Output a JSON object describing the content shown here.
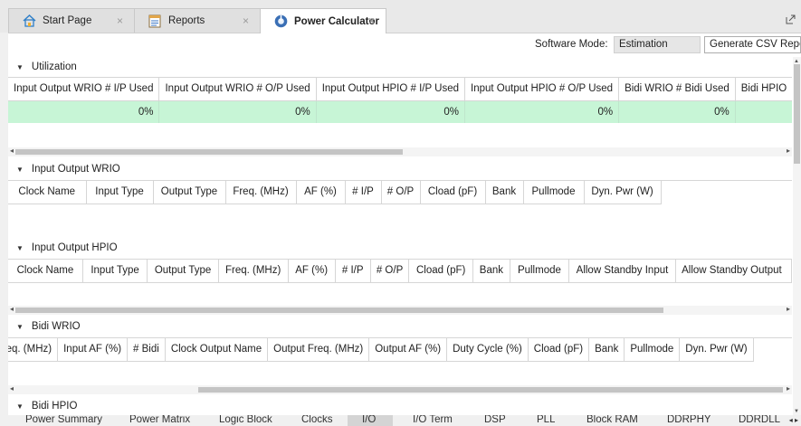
{
  "tabs": [
    {
      "label": "Start Page",
      "icon": "home-icon"
    },
    {
      "label": "Reports",
      "icon": "report-icon"
    },
    {
      "label": "Power Calculator",
      "icon": "power-calculator-icon"
    }
  ],
  "close_glyph": "×",
  "software_mode": {
    "label": "Software Mode:",
    "value": "Estimation",
    "generate_button": "Generate CSV Report"
  },
  "utilization": {
    "title": "Utilization",
    "headers": [
      "Input Output WRIO # I/P Used",
      "Input Output WRIO # O/P Used",
      "Input Output HPIO # I/P Used",
      "Input Output HPIO # O/P Used",
      "Bidi WRIO # Bidi Used",
      "Bidi HPIO"
    ],
    "values": [
      "0%",
      "0%",
      "0%",
      "0%",
      "0%",
      ""
    ]
  },
  "io_wrio": {
    "title": "Input Output WRIO",
    "headers": [
      "Clock Name",
      "Input Type",
      "Output Type",
      "Freq. (MHz)",
      "AF (%)",
      "# I/P",
      "# O/P",
      "Cload (pF)",
      "Bank",
      "Pullmode",
      "Dyn. Pwr (W)"
    ]
  },
  "io_hpio": {
    "title": "Input Output HPIO",
    "headers": [
      "Clock Name",
      "Input Type",
      "Output Type",
      "Freq. (MHz)",
      "AF (%)",
      "# I/P",
      "# O/P",
      "Cload (pF)",
      "Bank",
      "Pullmode",
      "Allow Standby Input",
      "Allow Standby Output"
    ]
  },
  "bidi_wrio": {
    "title": "Bidi WRIO",
    "headers": [
      "Input Freq. (MHz)",
      "Input AF (%)",
      "# Bidi",
      "Clock Output Name",
      "Output Freq. (MHz)",
      "Output AF (%)",
      "Duty Cycle (%)",
      "Cload (pF)",
      "Bank",
      "Pullmode",
      "Dyn. Pwr (W)"
    ]
  },
  "bidi_hpio": {
    "title": "Bidi HPIO"
  },
  "bottom_tabs": [
    "Power Summary",
    "Power Matrix",
    "Logic Block",
    "Clocks",
    "I/O",
    "I/O Term",
    "DSP",
    "PLL",
    "Block RAM",
    "DDRPHY",
    "DDRDLL"
  ],
  "active_bottom_tab": "I/O",
  "colors": {
    "accent_row": "#c7f5d6",
    "active_tab": "#ffffff",
    "background": "#f0f0f0"
  }
}
